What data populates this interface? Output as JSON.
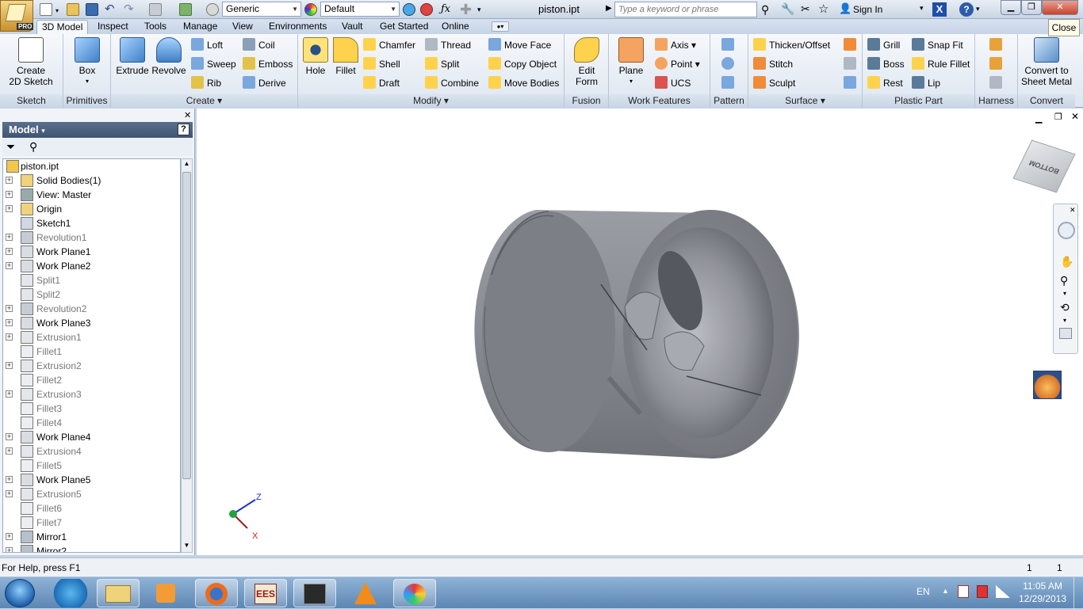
{
  "app": {
    "badge": "PRO"
  },
  "qat": {
    "material": "Generic",
    "appearance": "Default",
    "document_title": "piston.ipt",
    "search_placeholder": "Type a keyword or phrase",
    "sign_in": "Sign In",
    "close_tooltip": "Close"
  },
  "tabs": [
    "3D Model",
    "Inspect",
    "Tools",
    "Manage",
    "View",
    "Environments",
    "Vault",
    "Get Started",
    "Online"
  ],
  "active_tab": "3D Model",
  "ribbon": {
    "sketch": {
      "create_2d_sketch": "Create\n2D Sketch",
      "footer": "Sketch"
    },
    "primitives": {
      "box": "Box",
      "footer": "Primitives"
    },
    "create": {
      "extrude": "Extrude",
      "revolve": "Revolve",
      "loft": "Loft",
      "sweep": "Sweep",
      "rib": "Rib",
      "coil": "Coil",
      "emboss": "Emboss",
      "derive": "Derive",
      "footer": "Create"
    },
    "modify": {
      "hole": "Hole",
      "fillet": "Fillet",
      "chamfer": "Chamfer",
      "shell": "Shell",
      "draft": "Draft",
      "thread": "Thread",
      "split": "Split",
      "combine": "Combine",
      "move_face": "Move Face",
      "copy_object": "Copy Object",
      "move_bodies": "Move Bodies",
      "footer": "Modify"
    },
    "fusion": {
      "edit_form": "Edit\nForm",
      "footer": "Fusion"
    },
    "work_features": {
      "plane": "Plane",
      "axis": "Axis",
      "point": "Point",
      "ucs": "UCS",
      "footer": "Work Features"
    },
    "pattern": {
      "footer": "Pattern"
    },
    "surface": {
      "thicken_offset": "Thicken/Offset",
      "stitch": "Stitch",
      "sculpt": "Sculpt",
      "footer": "Surface"
    },
    "plastic_part": {
      "grill": "Grill",
      "boss": "Boss",
      "rest": "Rest",
      "snap_fit": "Snap Fit",
      "rule_fillet": "Rule Fillet",
      "lip": "Lip",
      "footer": "Plastic Part"
    },
    "harness": {
      "footer": "Harness"
    },
    "convert": {
      "convert_to_sheet_metal": "Convert to\nSheet Metal",
      "footer": "Convert"
    }
  },
  "browser": {
    "title": "Model",
    "nodes": [
      {
        "label": "piston.ipt",
        "icon": "part-icon",
        "expander": false,
        "dim": false,
        "root": true
      },
      {
        "label": "Solid Bodies(1)",
        "icon": "folder-icon",
        "expander": true,
        "dim": false
      },
      {
        "label": "View: Master",
        "icon": "view-icon",
        "expander": true,
        "dim": false
      },
      {
        "label": "Origin",
        "icon": "folder-icon",
        "expander": true,
        "dim": false
      },
      {
        "label": "Sketch1",
        "icon": "sketch-icon",
        "expander": false,
        "dim": false
      },
      {
        "label": "Revolution1",
        "icon": "revolve-feature-icon",
        "expander": true,
        "dim": true
      },
      {
        "label": "Work Plane1",
        "icon": "work-plane-icon",
        "expander": true,
        "dim": false
      },
      {
        "label": "Work Plane2",
        "icon": "work-plane-icon",
        "expander": true,
        "dim": false
      },
      {
        "label": "Split1",
        "icon": "split-feature-icon",
        "expander": false,
        "dim": true
      },
      {
        "label": "Split2",
        "icon": "split-feature-icon",
        "expander": false,
        "dim": true
      },
      {
        "label": "Revolution2",
        "icon": "revolve-feature-icon",
        "expander": true,
        "dim": true
      },
      {
        "label": "Work Plane3",
        "icon": "work-plane-icon",
        "expander": true,
        "dim": false
      },
      {
        "label": "Extrusion1",
        "icon": "extrude-feature-icon",
        "expander": true,
        "dim": true
      },
      {
        "label": "Fillet1",
        "icon": "fillet-feature-icon",
        "expander": false,
        "dim": true
      },
      {
        "label": "Extrusion2",
        "icon": "extrude-feature-icon",
        "expander": true,
        "dim": true
      },
      {
        "label": "Fillet2",
        "icon": "fillet-feature-icon",
        "expander": false,
        "dim": true
      },
      {
        "label": "Extrusion3",
        "icon": "extrude-feature-icon",
        "expander": true,
        "dim": true
      },
      {
        "label": "Fillet3",
        "icon": "fillet-feature-icon",
        "expander": false,
        "dim": true
      },
      {
        "label": "Fillet4",
        "icon": "fillet-feature-icon",
        "expander": false,
        "dim": true
      },
      {
        "label": "Work Plane4",
        "icon": "work-plane-icon",
        "expander": true,
        "dim": false
      },
      {
        "label": "Extrusion4",
        "icon": "extrude-feature-icon",
        "expander": true,
        "dim": true
      },
      {
        "label": "Fillet5",
        "icon": "fillet-feature-icon",
        "expander": false,
        "dim": true
      },
      {
        "label": "Work Plane5",
        "icon": "work-plane-icon",
        "expander": true,
        "dim": false
      },
      {
        "label": "Extrusion5",
        "icon": "extrude-feature-icon",
        "expander": true,
        "dim": true
      },
      {
        "label": "Fillet6",
        "icon": "fillet-feature-icon",
        "expander": false,
        "dim": true
      },
      {
        "label": "Fillet7",
        "icon": "fillet-feature-icon",
        "expander": false,
        "dim": true
      },
      {
        "label": "Mirror1",
        "icon": "mirror-feature-icon",
        "expander": true,
        "dim": false
      },
      {
        "label": "Mirror2",
        "icon": "mirror-feature-icon",
        "expander": true,
        "dim": false
      }
    ]
  },
  "viewport": {
    "viewcube_face": "BOTTOM",
    "triad": {
      "z": "Z",
      "x": "X"
    }
  },
  "status": {
    "help": "For Help, press F1",
    "count_a": "1",
    "count_b": "1"
  },
  "taskbar": {
    "lang": "EN",
    "time": "11:05 AM",
    "date": "12/29/2013",
    "buttons": [
      "start-orb-icon",
      "internet-explorer-icon",
      "file-explorer-icon",
      "media-player-icon",
      "firefox-icon",
      "ees-app-icon",
      "inventor-taskbar-icon",
      "vlc-icon",
      "paint-icon"
    ]
  },
  "colors": {
    "part": "#8a8d93",
    "accent": "#3f5474",
    "selection": "#ffd24d"
  }
}
